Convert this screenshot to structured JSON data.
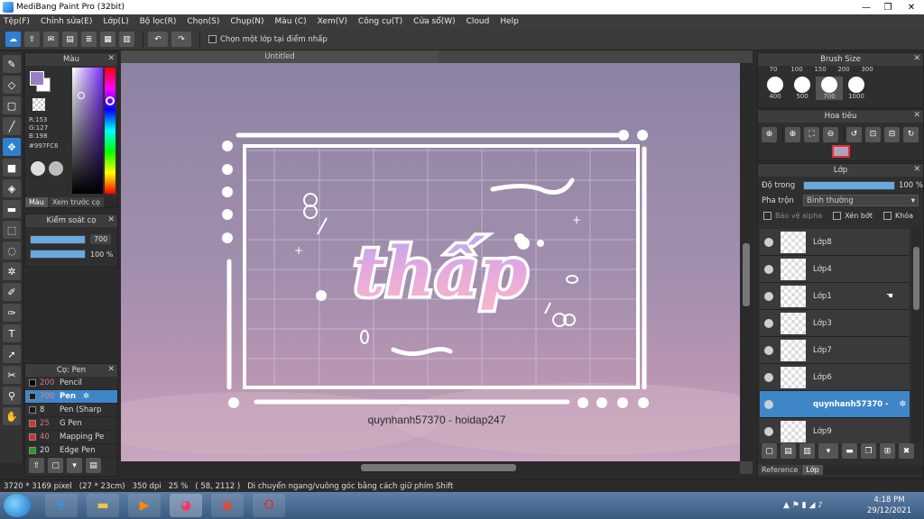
{
  "app": {
    "title": "MediBang Paint Pro (32bit)"
  },
  "menu": [
    "Tệp(F)",
    "Chỉnh sửa(E)",
    "Lớp(L)",
    "Bộ lọc(R)",
    "Chọn(S)",
    "Chụp(N)",
    "Màu (C)",
    "Xem(V)",
    "Công cụ(T)",
    "Cửa sổ(W)",
    "Cloud",
    "Help"
  ],
  "toolbar": {
    "select_layer_label": "Chọn một lớp tại điểm nhấp"
  },
  "document": {
    "tab_title": "Untitled"
  },
  "artwork": {
    "word": "thấp",
    "credit": "quynhanh57370 - hoidap247"
  },
  "color_panel": {
    "title": "Màu",
    "r": "R:153",
    "g": "G:127",
    "b": "B:198",
    "hex": "#997FC6",
    "tab_color": "Màu",
    "tab_preview": "Xem trước cọ",
    "current_color": "#997fc6"
  },
  "brush_control": {
    "title": "Kiểm soát cọ",
    "size": "700",
    "opacity": "100 %"
  },
  "brush_panel": {
    "title": "Cọ: Pen",
    "items": [
      {
        "size": "200",
        "name": "Pencil",
        "color": "#000000"
      },
      {
        "size": "700",
        "name": "Pen",
        "color": "#1a1a1a"
      },
      {
        "size": "8",
        "name": "Pen (Sharp",
        "color": "#1a1a1a"
      },
      {
        "size": "25",
        "name": "G Pen",
        "color": "#d93030"
      },
      {
        "size": "40",
        "name": "Mapping Pe",
        "color": "#d93030"
      },
      {
        "size": "20",
        "name": "Edge Pen",
        "color": "#20a020"
      }
    ]
  },
  "brush_size_panel": {
    "title": "Brush Size",
    "top_labels": [
      "70",
      "100",
      "150",
      "200",
      "300"
    ],
    "labels": [
      "400",
      "500",
      "700",
      "1000"
    ]
  },
  "navigator": {
    "title": "Hoa tiêu"
  },
  "layers_panel": {
    "title": "Lớp",
    "opacity_label": "Độ trong",
    "opacity_value": "100 %",
    "blend_label": "Pha trộn",
    "blend_value": "Bình thường",
    "protect_alpha": "Bảo vệ alpha",
    "clipping": "Xén bớt",
    "lock": "Khóa",
    "layers": [
      "Lớp8",
      "Lớp4",
      "Lớp1",
      "Lớp3",
      "Lớp7",
      "Lớp6",
      "quynhanh57370 -",
      "Lớp9"
    ],
    "tab_reference": "Reference",
    "tab_layer": "Lớp"
  },
  "status": {
    "size": "3720 * 3169 pixel",
    "cm": "(27 * 23cm)",
    "dpi": "350 dpi",
    "zoom": "25 %",
    "coords": "( 58, 2112 )",
    "hint": "Di chuyển ngang/vuông góc bằng cách giữ phím Shift"
  },
  "taskbar": {
    "time": "4:18 PM",
    "date": "29/12/2021"
  }
}
